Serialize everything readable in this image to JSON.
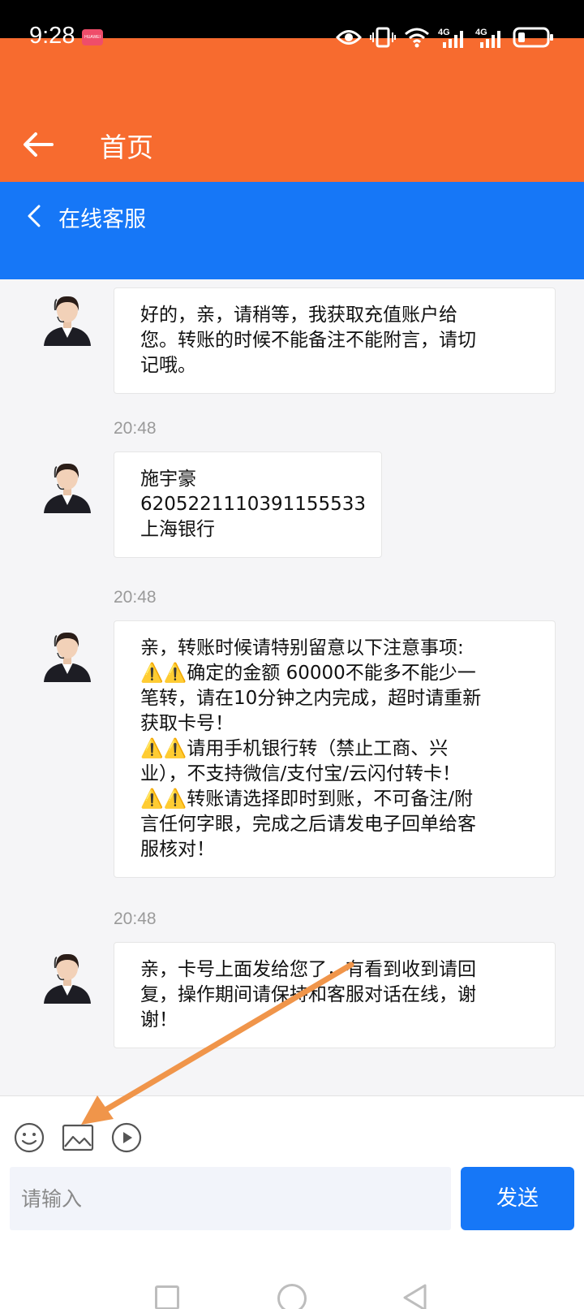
{
  "status_bar": {
    "time": "9:28",
    "brand_badge": "HUAWEI",
    "network_1": "4G",
    "network_2": "4G"
  },
  "app_header": {
    "title": "首页",
    "color": "#f76b2f"
  },
  "chat_header": {
    "title": "在线客服",
    "color": "#1677f7"
  },
  "messages": [
    {
      "timestamp": "",
      "text": "好的，亲，请稍等，我获取充值账户给\n您。转账的时候不能备注不能附言，请切\n记哦。"
    },
    {
      "timestamp": "20:48",
      "text": "施宇豪\n6205221110391155533\n上海银行"
    },
    {
      "timestamp": "20:48",
      "text": "亲，转账时候请特别留意以下注意事项:\n⚠️⚠️确定的金额 60000不能多不能少一\n笔转，请在10分钟之内完成，超时请重新\n获取卡号！\n⚠️⚠️请用手机银行转（禁止工商、兴\n业），不支持微信/支付宝/云闪付转卡！\n⚠️⚠️转账请选择即时到账，不可备注/附\n言任何字眼，完成之后请发电子回单给客\n服核对！"
    },
    {
      "timestamp": "20:48",
      "text": "亲，卡号上面发给您了，有看到收到请回\n复，操作期间请保持和客服对话在线，谢\n谢！"
    }
  ],
  "composer": {
    "placeholder": "请输入",
    "send_label": "发送",
    "icons": [
      "emoji-icon",
      "image-icon",
      "video-icon"
    ]
  },
  "annotation": {
    "arrow_color": "#f0954a"
  },
  "system_nav": {
    "icons": [
      "recent-apps-icon",
      "home-icon",
      "back-icon"
    ]
  }
}
